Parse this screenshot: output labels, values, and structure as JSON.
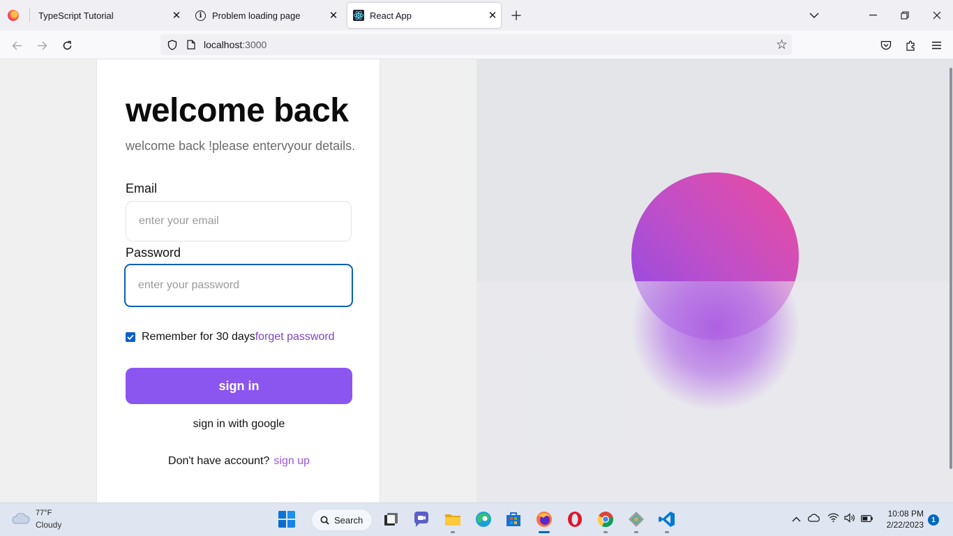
{
  "browser": {
    "tabs": [
      {
        "title": "TypeScript Tutorial",
        "icon": "firefox-icon",
        "active": false
      },
      {
        "title": "Problem loading page",
        "icon": "info-icon",
        "active": false
      },
      {
        "title": "React App",
        "icon": "react-icon",
        "active": true
      }
    ],
    "url_host": "localhost",
    "url_port": ":3000"
  },
  "page": {
    "title": "welcome back",
    "subtitle": "welcome back !please entervyour details.",
    "email_label": "Email",
    "email_placeholder": "enter your email",
    "email_value": "",
    "password_label": "Password",
    "password_placeholder": "enter your password",
    "password_value": "",
    "remember_label": "Remember for 30 days",
    "remember_checked": true,
    "forgot_link": "forget password",
    "signin_button": "sign in",
    "google_button": "sign in with google",
    "no_account_text": "Don't have account?",
    "signup_link": "sign up",
    "colors": {
      "accent": "#8b55f0",
      "link": "#7b45c6",
      "circle_start": "#8a4ae8",
      "circle_end": "#ec4b9e"
    }
  },
  "taskbar": {
    "weather_temp": "77°F",
    "weather_desc": "Cloudy",
    "search_label": "Search",
    "time": "10:08 PM",
    "date": "2/22/2023",
    "notification_count": "1",
    "apps": [
      "start-icon",
      "search",
      "task-view-icon",
      "teams-chat-icon",
      "file-explorer-icon",
      "edge-icon",
      "store-icon",
      "firefox-icon",
      "opera-icon",
      "chrome-icon",
      "git-kraken-icon",
      "vscode-icon"
    ]
  }
}
